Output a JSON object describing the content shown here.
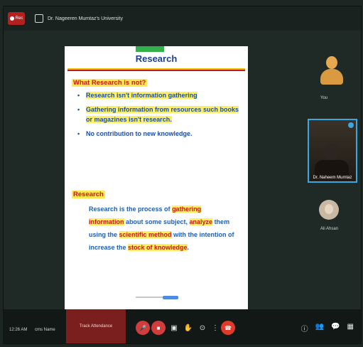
{
  "window": {
    "rec_label": "Rec",
    "title": "Dr. Nageeren Mumtaz's University"
  },
  "slide": {
    "title": "Research",
    "what_not_heading": "What Research is not?",
    "bullets": [
      "Research isn't information gathering",
      "Gathering information from resources such books or magazines isn't research.",
      "No contribution to new knowledge."
    ],
    "research_heading": "Research",
    "para": {
      "p1": "Research is the process of ",
      "h1": "gathering information",
      "p2": " about some subject, ",
      "h2": "analyze",
      "p3": " them using the ",
      "h3": "scientific method",
      "p4": " with the intention of increase the ",
      "h4": "stock of knowledge",
      "p5": "."
    }
  },
  "participants": {
    "you_label": "You",
    "active_name": "Dr. Naheem Mumtaz",
    "ali_label": "Ali Ahsan"
  },
  "bottom": {
    "left_text_1": "12:26 AM",
    "left_text_2": "cms Name",
    "attendance_label": "Track Attendance"
  },
  "icons": {
    "mic": "mic-icon",
    "camera": "camera-icon",
    "share": "share-icon",
    "hand": "raise-hand-icon",
    "more": "more-icon",
    "end": "end-call-icon"
  }
}
